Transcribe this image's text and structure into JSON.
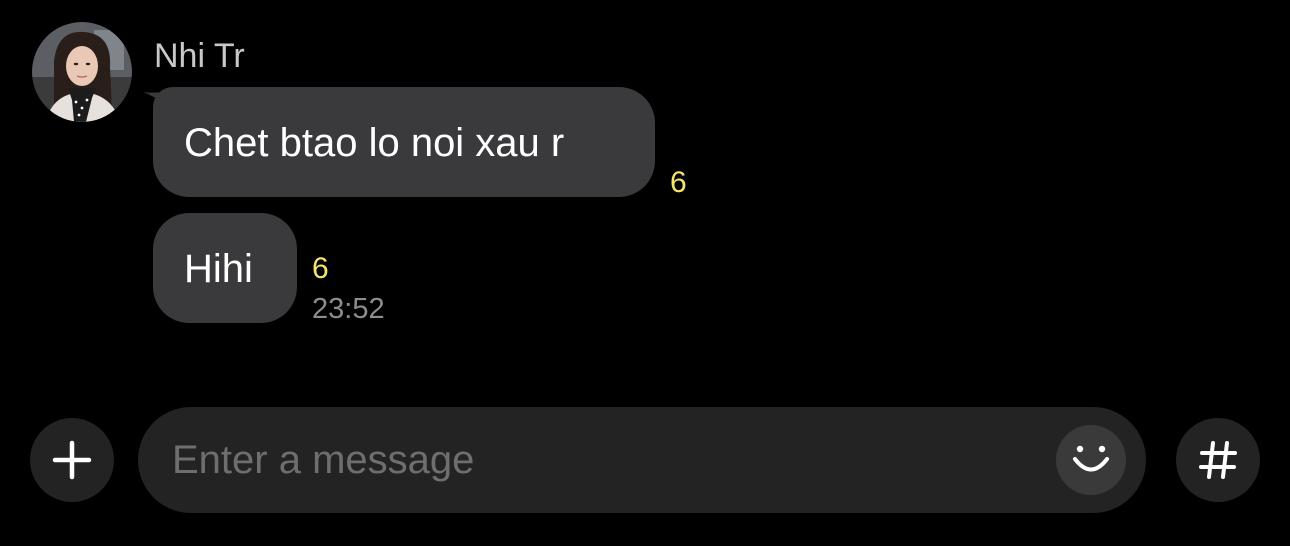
{
  "conversation": {
    "sender": {
      "name": "Nhi Tr",
      "avatar_icon": "profile-photo"
    },
    "messages": [
      {
        "text": "Chet btao lo noi xau r",
        "unread_count": "6"
      },
      {
        "text": "Hihi",
        "unread_count": "6",
        "time": "23:52"
      }
    ]
  },
  "composer": {
    "placeholder": "Enter a message",
    "value": "",
    "add_icon": "plus-icon",
    "emoji_icon": "emoji-icon",
    "hash_icon": "hashtag-icon"
  },
  "colors": {
    "background": "#000000",
    "bubble": "#3a3a3c",
    "unread": "#f5e46a",
    "timestamp": "#8d8d8d",
    "input_bg": "#232323"
  }
}
